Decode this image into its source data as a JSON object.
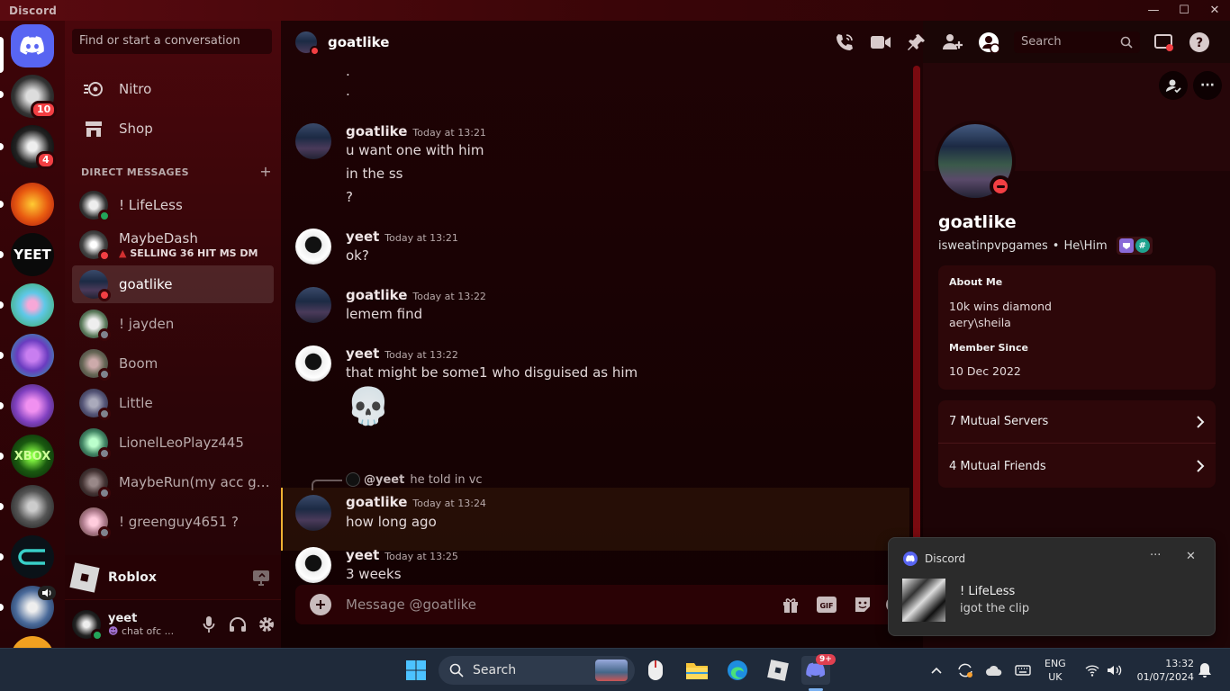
{
  "app": {
    "title": "Discord"
  },
  "window_controls": {
    "minimize": "—",
    "maximize": "☐",
    "close": "✕"
  },
  "rail": {
    "badges": [
      "10",
      "4"
    ],
    "servers": [
      "home",
      "server-1",
      "server-2",
      "server-3",
      "server-yeet",
      "server-5",
      "server-6",
      "server-7",
      "server-xbox",
      "server-9",
      "server-10",
      "server-11"
    ]
  },
  "sidebar": {
    "search_placeholder": "Find or start a conversation",
    "nav": [
      {
        "label": "Nitro"
      },
      {
        "label": "Shop"
      }
    ],
    "dm_header": "DIRECT MESSAGES",
    "add_dm": "+",
    "dms": [
      {
        "name": "! LifeLess",
        "status": "online"
      },
      {
        "name": "MaybeDash",
        "sub": "SELLING 36 HIT MS DM",
        "status": "dnd"
      },
      {
        "name": "goatlike",
        "status": "dnd"
      },
      {
        "name": "! jayden",
        "status": "offline"
      },
      {
        "name": "Boom",
        "status": "offline"
      },
      {
        "name": "Little",
        "status": "offline"
      },
      {
        "name": "LionelLeoPlayz445",
        "status": "offline"
      },
      {
        "name": "MaybeRun(my acc got...",
        "status": "offline"
      },
      {
        "name": "! greenguy4651 ?",
        "status": "offline"
      }
    ],
    "activity": {
      "name": "Roblox"
    },
    "user": {
      "name": "yeet",
      "status_text": "chat ofc ..."
    }
  },
  "chat": {
    "header_name": "goatlike",
    "header_search": "Search",
    "composer_placeholder": "Message @goatlike",
    "messages": [
      {
        "author": "",
        "time": "",
        "lines": [
          ".",
          "."
        ]
      },
      {
        "author": "goatlike",
        "time": "Today at 13:21",
        "lines": [
          "u want one with him",
          "in the ss",
          "?"
        ]
      },
      {
        "author": "yeet",
        "time": "Today at 13:21",
        "lines": [
          "ok?"
        ]
      },
      {
        "author": "goatlike",
        "time": "Today at 13:22",
        "lines": [
          "lemem find"
        ]
      },
      {
        "author": "yeet",
        "time": "Today at 13:22",
        "lines": [
          "that might be some1 who disguised as him"
        ],
        "emoji": "💀"
      },
      {
        "author": "goatlike",
        "time": "Today at 13:24",
        "reply_to": "@yeet",
        "reply_text": "he told in vc",
        "lines": [
          "how long ago"
        ]
      },
      {
        "author": "yeet",
        "time": "Today at 13:25",
        "lines": [
          "3 weeks"
        ]
      }
    ]
  },
  "profile": {
    "display_name": "goatlike",
    "username": "isweatinpvpgames",
    "pronouns": "He\\Him",
    "about_title": "About Me",
    "about_lines": [
      "10k wins diamond",
      "aery\\sheila"
    ],
    "member_since_title": "Member Since",
    "member_since": "10 Dec 2022",
    "mutual_servers": "7 Mutual Servers",
    "mutual_friends": "4 Mutual Friends"
  },
  "toast": {
    "app": "Discord",
    "title": "! LifeLess",
    "body": "igot the clip",
    "more": "···",
    "close": "✕"
  },
  "taskbar": {
    "search": "Search",
    "chat_badge": "9+",
    "lang": "ENG",
    "region": "UK",
    "time": "13:32",
    "date": "01/07/2024"
  },
  "colors": {
    "accent": "#5865f2",
    "online": "#23a55a",
    "dnd": "#f23f43",
    "offline": "#80848e",
    "reply_highlight": "#f0b232"
  }
}
